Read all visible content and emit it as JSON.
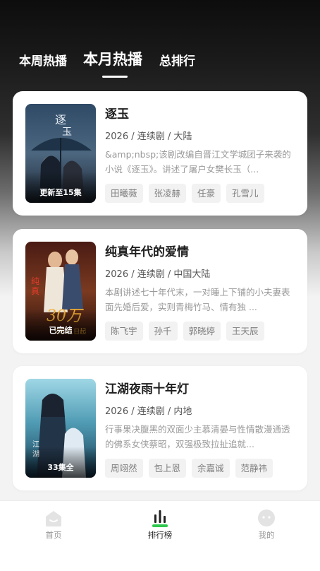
{
  "tabs": [
    {
      "label": "本周热播",
      "active": false
    },
    {
      "label": "本月热播",
      "active": true
    },
    {
      "label": "总排行",
      "active": false
    }
  ],
  "cards": [
    {
      "title": "逐玉",
      "meta": "2026 / 连续剧 / 大陆",
      "desc": "&amp;nbsp;该剧改编自晋江文学城团子来袭的小说《逐玉》。讲述了屠户女樊长玉（...",
      "badge": "更新至15集",
      "tags": [
        "田曦薇",
        "张凌赫",
        "任豪",
        "孔雪儿"
      ]
    },
    {
      "title": "纯真年代的爱情",
      "meta": "2026 / 连续剧 / 中国大陆",
      "desc": "本剧讲述七十年代末，一对睡上下铺的小夫妻表面先婚后爱，实则青梅竹马、情有独 ...",
      "badge": "已完结",
      "tags": [
        "陈飞宇",
        "孙千",
        "郭晓婷",
        "王天辰"
      ]
    },
    {
      "title": "江湖夜雨十年灯",
      "meta": "2026 / 连续剧 / 内地",
      "desc": "行事果决腹黑的双面少主慕清晏与性情散漫通透的佛系女侠蔡昭，双强极致拉扯追就...",
      "badge": "33集全",
      "tags": [
        "周翊然",
        "包上恩",
        "余嘉诚",
        "范静祎"
      ]
    }
  ],
  "nav": [
    {
      "label": "首页",
      "icon": "home-icon"
    },
    {
      "label": "排行榜",
      "icon": "ranking-icon"
    },
    {
      "label": "我的",
      "icon": "profile-icon"
    }
  ],
  "colors": {
    "accent": "#2dc84d",
    "active_label": "#222222",
    "inactive": "#999999"
  }
}
